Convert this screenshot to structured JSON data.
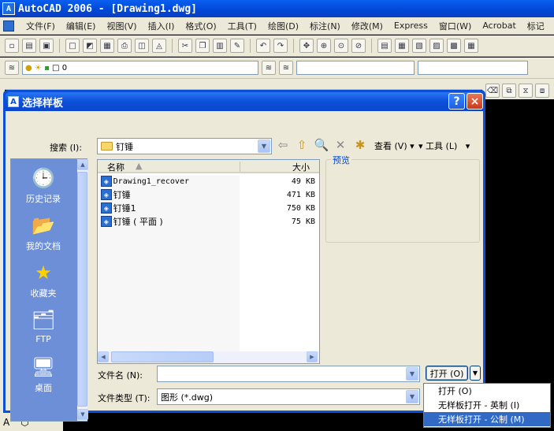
{
  "app": {
    "title": "AutoCAD 2006 - [Drawing1.dwg]",
    "icon_label": "A"
  },
  "menubar": [
    "文件(F)",
    "编辑(E)",
    "视图(V)",
    "插入(I)",
    "格式(O)",
    "工具(T)",
    "绘图(D)",
    "标注(N)",
    "修改(M)",
    "Express",
    "窗口(W)",
    "Acrobat",
    "标记"
  ],
  "layer_toolbar": {
    "layer_value": "0"
  },
  "dialog": {
    "title": "选择样板",
    "help": "?",
    "close": "×",
    "search_label": "搜索 (I):",
    "search_value": "钉锤",
    "view_label": "查看 (V)",
    "tools_label": "工具 (L)",
    "places": [
      {
        "label": "历史记录",
        "icon": "history-icon"
      },
      {
        "label": "我的文档",
        "icon": "my-documents-icon"
      },
      {
        "label": "收藏夹",
        "icon": "favorites-icon"
      },
      {
        "label": "FTP",
        "icon": "ftp-icon"
      },
      {
        "label": "桌面",
        "icon": "desktop-icon"
      }
    ],
    "columns": {
      "name": "名称",
      "size": "大小"
    },
    "files": [
      {
        "name": "Drawing1_recover",
        "size": "49 KB"
      },
      {
        "name": "钉锤",
        "size": "471 KB"
      },
      {
        "name": "钉锤1",
        "size": "750 KB"
      },
      {
        "name": "钉锤 ( 平面 )",
        "size": "75 KB"
      }
    ],
    "preview_label": "预览",
    "filename_label": "文件名 (N):",
    "filename_value": "",
    "filetype_label": "文件类型 (T):",
    "filetype_value": "图形 (*.dwg)",
    "open_button": "打开 (O)",
    "open_menu": [
      {
        "label": "打开 (O)",
        "selected": false
      },
      {
        "label": "无样板打开 - 英制 (I)",
        "selected": false
      },
      {
        "label": "无样板打开 - 公制 (M)",
        "selected": true
      }
    ]
  }
}
